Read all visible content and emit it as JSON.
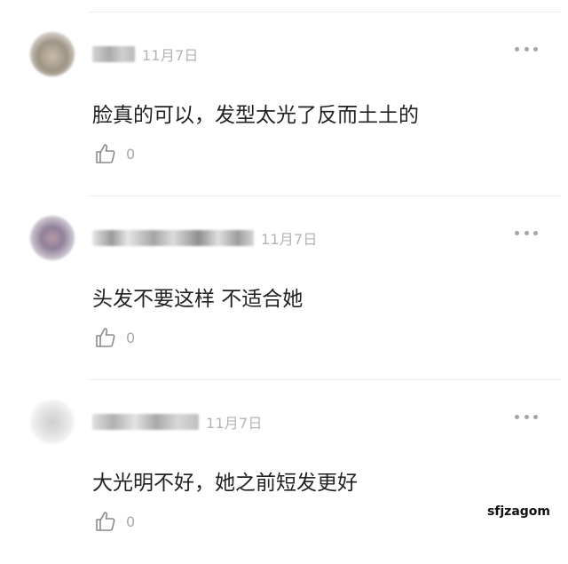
{
  "comments": [
    {
      "date": "11月7日",
      "text": "脸真的可以，发型太光了反而土土的",
      "likes": "0",
      "avatar_color": "#b7aa98",
      "icons": {
        "more": "more-icon",
        "like": "thumbs-up-icon"
      }
    },
    {
      "date": "11月7日",
      "text": "头发不要这样 不适合她",
      "likes": "0",
      "avatar_color": "#9b8fa3",
      "icons": {
        "more": "more-icon",
        "like": "thumbs-up-icon"
      }
    },
    {
      "date": "11月7日",
      "text": "大光明不好，她之前短发更好",
      "likes": "0",
      "avatar_color": "#d9d9d9",
      "icons": {
        "more": "more-icon",
        "like": "thumbs-up-icon"
      }
    }
  ],
  "watermark": "sfjzagom"
}
